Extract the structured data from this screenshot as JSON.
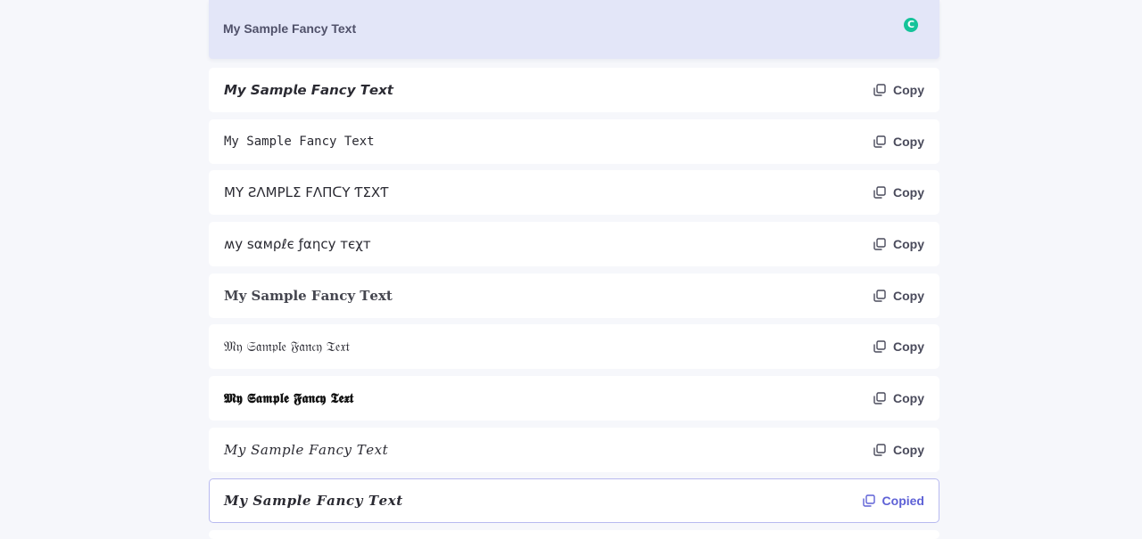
{
  "input": {
    "text": "My Sample Fancy Text",
    "grammar_icon_glyph": "C"
  },
  "rows": [
    {
      "text": "𝙈𝙮 𝙎𝙖𝙢𝙥𝙡𝙚 𝙁𝙖𝙣𝙘𝙮 𝙏𝙚𝙭𝙩",
      "button": "Copy"
    },
    {
      "text": "𝙼𝚢 𝚂𝚊𝚖𝚙𝚕𝚎 𝙵𝚊𝚗𝚌𝚢 𝚃𝚎𝚡𝚝",
      "button": "Copy"
    },
    {
      "text": "ΜΥ ƧΛΜΡᒪΣ FΛПᑕΥ ƬΣXƬ",
      "button": "Copy"
    },
    {
      "text": "ʍy sαмρℓє ƒαηcy тєχт",
      "button": "Copy"
    },
    {
      "text": "𝐌𝐲 𝐒𝐚𝐦𝐩𝐥𝐞 𝐅𝐚𝐧𝐜𝐲 𝐓𝐞𝐱𝐭",
      "button": "Copy"
    },
    {
      "text": "𝔐𝔶 𝔖𝔞𝔪𝔭𝔩𝔢 𝔉𝔞𝔫𝔠𝔶 𝔗𝔢𝔵𝔱",
      "button": "Copy"
    },
    {
      "text": "𝕸𝖞 𝕾𝖆𝖒𝖕𝖑𝖊 𝕱𝖆𝖓𝖈𝖞 𝕿𝖊𝖝𝖙",
      "button": "Copy"
    },
    {
      "text": "𝑀𝑦 𝑆𝑎𝑚𝑝𝑙𝑒 𝐹𝑎𝑛𝑐𝑦 𝑇𝑒𝑥𝑡",
      "button": "Copy"
    },
    {
      "text": "𝑴𝒚 𝑺𝒂𝒎𝒑𝒍𝒆 𝑭𝒂𝒏𝒄𝒚 𝑻𝒆𝒙𝒕",
      "button": "Copied"
    }
  ],
  "colors": {
    "accent": "#5e61d6",
    "grammarly": "#15c39a",
    "input_bg": "#e3e6f8"
  }
}
